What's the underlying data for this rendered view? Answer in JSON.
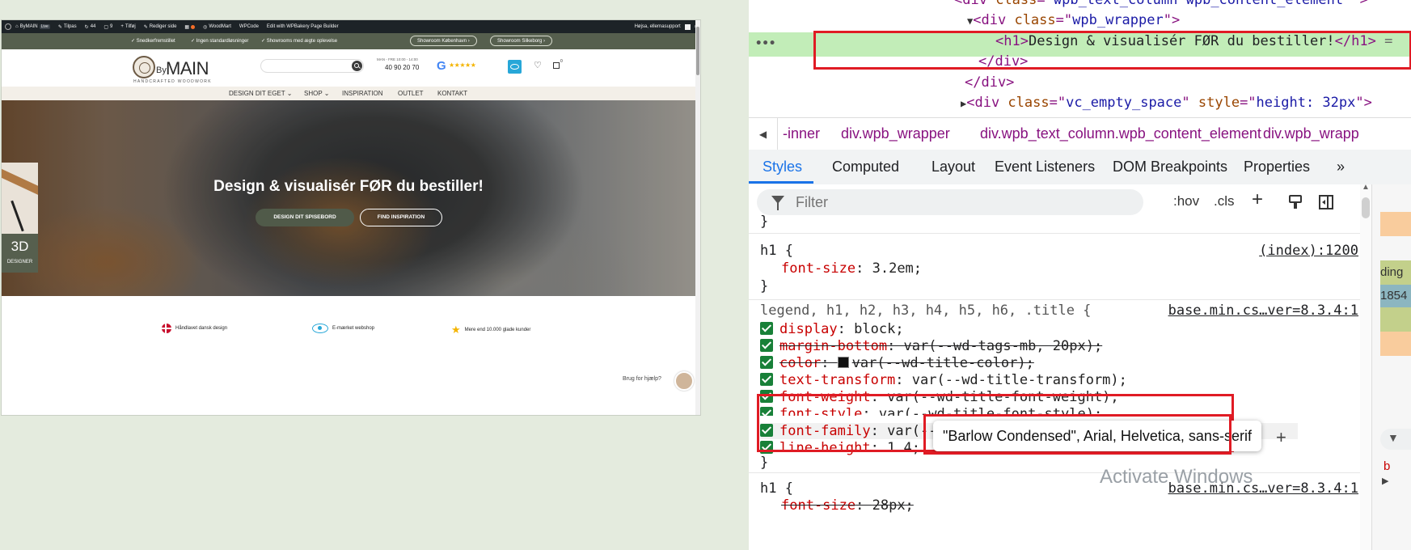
{
  "site": {
    "adminbar": {
      "site_name": "ByMAIN",
      "site_badge": "Live",
      "customize": "Tilpas",
      "comments": "44",
      "updates": "9",
      "new": "Tilføj",
      "edit_page": "Rediger side",
      "woodmart": "WoodMart",
      "wpcode": "WPCode",
      "wpbakery": "Edit with WPBakery Page Builder",
      "greeting": "Højsa, ellernasupport"
    },
    "topstrip": {
      "usps": [
        "Snedkerfremstillet",
        "Ingen standardløsninger",
        "Showrooms med ægte oplevelse"
      ],
      "showroom_kbh": "Showroom København ›",
      "showroom_silkeborg": "Showroom Silkeborg ›"
    },
    "header": {
      "logo_by": "By",
      "logo_main": "MAIN",
      "logo_tagline": "HANDCRAFTED WOODWORK",
      "search_placeholder": "",
      "hours": "MAN - FRE 10:00 - 14:00",
      "phone": "40 90 20 70",
      "google_stars": "★★★★★",
      "cart_count": "0"
    },
    "nav": [
      "DESIGN DIT EGET ⌄",
      "SHOP ⌄",
      "INSPIRATION",
      "OUTLET",
      "KONTAKT"
    ],
    "hero": {
      "title": "Design & visualisér FØR du bestiller!",
      "btn_design": "DESIGN DIT SPISEBORD",
      "btn_inspiration": "FIND INSPIRATION"
    },
    "designer": {
      "big": "3D",
      "small": "DESIGNER"
    },
    "usp_row": [
      "Håndlavet dansk design",
      "E-mærket webshop",
      "Mere end 10.000 glade kunder"
    ],
    "help": "Brug for hjælp?"
  },
  "devtools": {
    "dom": {
      "line1_attr": "class",
      "line1_val": "wpb_text_column wpb_content_element",
      "line2_tag": "div",
      "line2_attr": "class",
      "line2_val": "wpb_wrapper",
      "selected_text": "Design & visualisér FØR du bestiller!",
      "close_div": "</div>",
      "line5_attr": "class",
      "line5_val": "vc_empty_space",
      "line5_attr2": "style",
      "line5_val2": "height: 32px",
      "ellipsis": "•••"
    },
    "breadcrumbs": [
      "-inner",
      "div.wpb_wrapper",
      "div.wpb_text_column.wpb_content_element",
      "div.wpb_wrapp"
    ],
    "tabs": [
      "Styles",
      "Computed",
      "Layout",
      "Event Listeners",
      "DOM Breakpoints",
      "Properties",
      "»"
    ],
    "filter_placeholder": "Filter",
    "hov": ":hov",
    "cls": ".cls",
    "rules": {
      "r1_selector": "h1 {",
      "r1_source": "(index):1200",
      "r1_prop": "font-size",
      "r1_val": "3.2em;",
      "r2_selector": "legend, h1, h2, h3, h4, h5, h6, .title {",
      "r2_source": "base.min.cs…ver=8.3.4:1",
      "r2_decls": [
        {
          "p": "display",
          "v": "block;"
        },
        {
          "p": "margin-bottom",
          "v": "var(--wd-tags-mb, 20px);"
        },
        {
          "p": "color",
          "v": "var(--wd-title-color);"
        },
        {
          "p": "text-transform",
          "v": "var(--wd-title-transform);"
        },
        {
          "p": "font-weight",
          "v": "var(--wd-title-font-weight);"
        },
        {
          "p": "font-style",
          "v": "var(--wd-title-font-style);"
        },
        {
          "p": "font-family",
          "v": "var(--wd-title-font);"
        },
        {
          "p": "line-height",
          "v": "1.4;"
        }
      ],
      "r3_selector": "h1 {",
      "r3_source": "base.min.cs…ver=8.3.4:1",
      "r3_prop": "font-size",
      "r3_val": "28px;"
    },
    "tooltip": "\"Barlow Condensed\", Arial, Helvetica, sans-serif",
    "right_panel": [
      "ding",
      "1854"
    ],
    "watermark": "Activate Windows"
  }
}
